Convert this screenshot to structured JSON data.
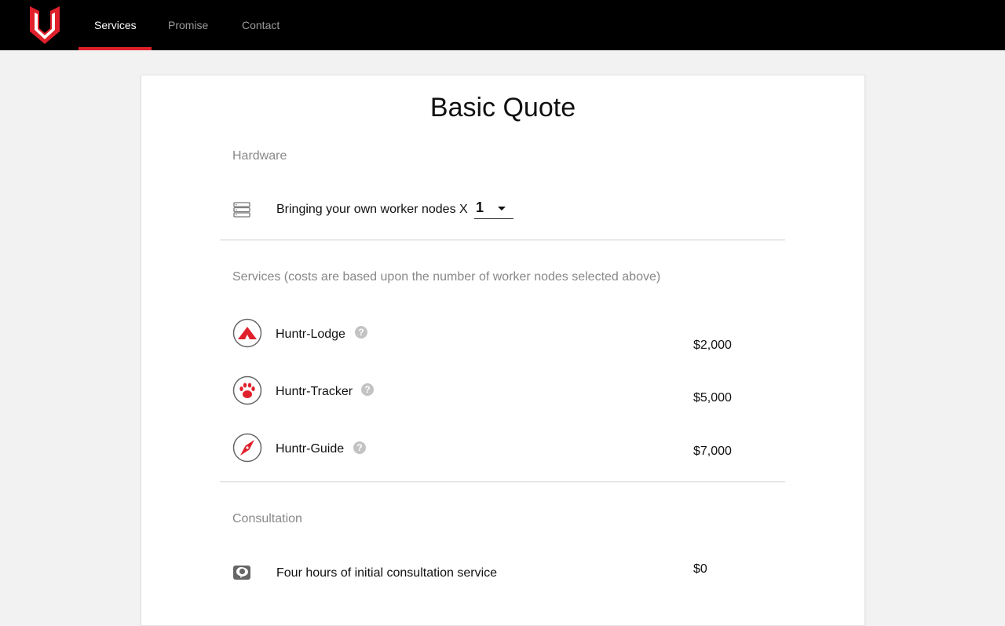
{
  "nav": {
    "tabs": [
      {
        "label": "Services",
        "active": true
      },
      {
        "label": "Promise",
        "active": false
      },
      {
        "label": "Contact",
        "active": false
      }
    ]
  },
  "quote": {
    "title": "Basic Quote",
    "hardware": {
      "section_label": "Hardware",
      "text": "Bringing your own worker nodes X",
      "selected_nodes": "1"
    },
    "services": {
      "section_label": "Services (costs are based upon the number of worker nodes selected above)",
      "items": [
        {
          "name": "Huntr-Lodge",
          "price": "$2,000",
          "help": "?"
        },
        {
          "name": "Huntr-Tracker",
          "price": "$5,000",
          "help": "?"
        },
        {
          "name": "Huntr-Guide",
          "price": "$7,000",
          "help": "?"
        }
      ]
    },
    "consultation": {
      "section_label": "Consultation",
      "text": "Four hours of initial consultation service",
      "price": "$0"
    }
  },
  "colors": {
    "accent": "#e0202b",
    "nav_bg": "#000000",
    "muted": "#888888"
  }
}
